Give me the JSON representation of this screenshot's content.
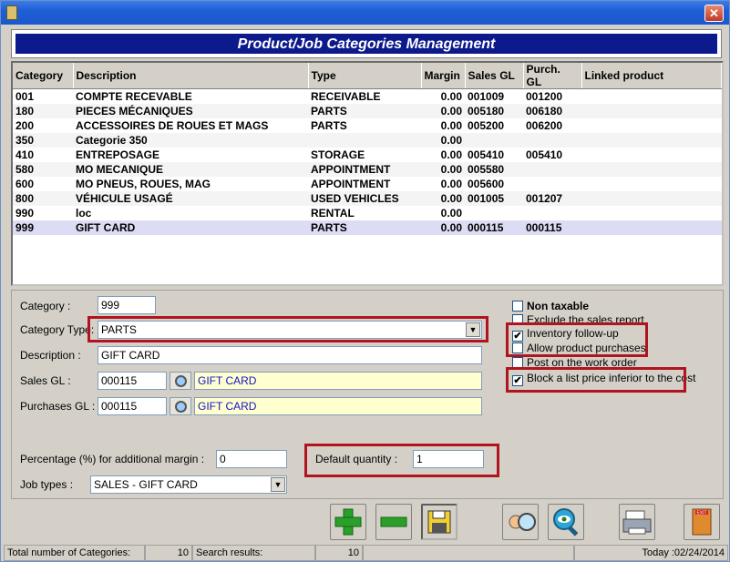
{
  "window": {
    "title": ""
  },
  "banner": {
    "title": "Product/Job Categories Management"
  },
  "grid": {
    "columns": [
      "Category",
      "Description",
      "Type",
      "Margin",
      "Sales GL",
      "Purch. GL",
      "Linked product"
    ],
    "rows": [
      [
        "001",
        "COMPTE RECEVABLE",
        "RECEIVABLE",
        "0.00",
        "001009",
        "001200",
        ""
      ],
      [
        "180",
        "PIECES MÉCANIQUES",
        "PARTS",
        "0.00",
        "005180",
        "006180",
        ""
      ],
      [
        "200",
        "ACCESSOIRES DE ROUES ET MAGS",
        "PARTS",
        "0.00",
        "005200",
        "006200",
        ""
      ],
      [
        "350",
        "Categorie 350",
        "",
        "0.00",
        "",
        "",
        ""
      ],
      [
        "410",
        "ENTREPOSAGE",
        "STORAGE",
        "0.00",
        "005410",
        "005410",
        ""
      ],
      [
        "580",
        "MO MECANIQUE",
        "APPOINTMENT",
        "0.00",
        "005580",
        "",
        ""
      ],
      [
        "600",
        "MO PNEUS, ROUES, MAG",
        "APPOINTMENT",
        "0.00",
        "005600",
        "",
        ""
      ],
      [
        "800",
        "VÉHICULE USAGÉ",
        "USED VEHICLES",
        "0.00",
        "001005",
        "001207",
        ""
      ],
      [
        "990",
        "loc",
        "RENTAL",
        "0.00",
        "",
        "",
        ""
      ],
      [
        "999",
        "GIFT CARD",
        "PARTS",
        "0.00",
        "000115",
        "000115",
        ""
      ]
    ]
  },
  "form": {
    "category_label": "Category :",
    "category_value": "999",
    "category_type_label": "Category Type:",
    "category_type_value": "PARTS",
    "description_label": "Description :",
    "description_value": "GIFT CARD",
    "sales_gl_label": "Sales GL :",
    "sales_gl_value": "000115",
    "sales_gl_desc": "GIFT CARD",
    "purchases_gl_label": "Purchases GL :",
    "purchases_gl_value": "000115",
    "purchases_gl_desc": "GIFT CARD",
    "margin_label": "Percentage (%) for additional margin :",
    "margin_value": "0",
    "default_qty_label": "Default quantity :",
    "default_qty_value": "1",
    "job_types_label": "Job types :",
    "job_types_value": "SALES - GIFT CARD"
  },
  "checks": {
    "non_taxable": {
      "label": "Non taxable",
      "checked": false
    },
    "exclude_sales": {
      "label": "Exclude the sales report",
      "checked": false
    },
    "inventory": {
      "label": "Inventory follow-up",
      "checked": true
    },
    "allow_purchases": {
      "label": "Allow product purchases",
      "checked": false
    },
    "post_work_order": {
      "label": "Post on the work order",
      "checked": false
    },
    "block_price": {
      "label": "Block a list price inferior to the cost",
      "checked": true
    }
  },
  "status": {
    "total_label": "Total number of Categories:",
    "total_value": "10",
    "search_label": "Search results:",
    "search_value": "10",
    "today": "Today :02/24/2014"
  },
  "colors": {
    "banner": "#0c1a8c",
    "highlight": "#b0141e",
    "selected_row": "#dcdcf4"
  },
  "icons": [
    "add-icon",
    "remove-icon",
    "save-icon",
    "search-person-icon",
    "zoom-eye-icon",
    "printer-icon",
    "exit-door-icon"
  ]
}
